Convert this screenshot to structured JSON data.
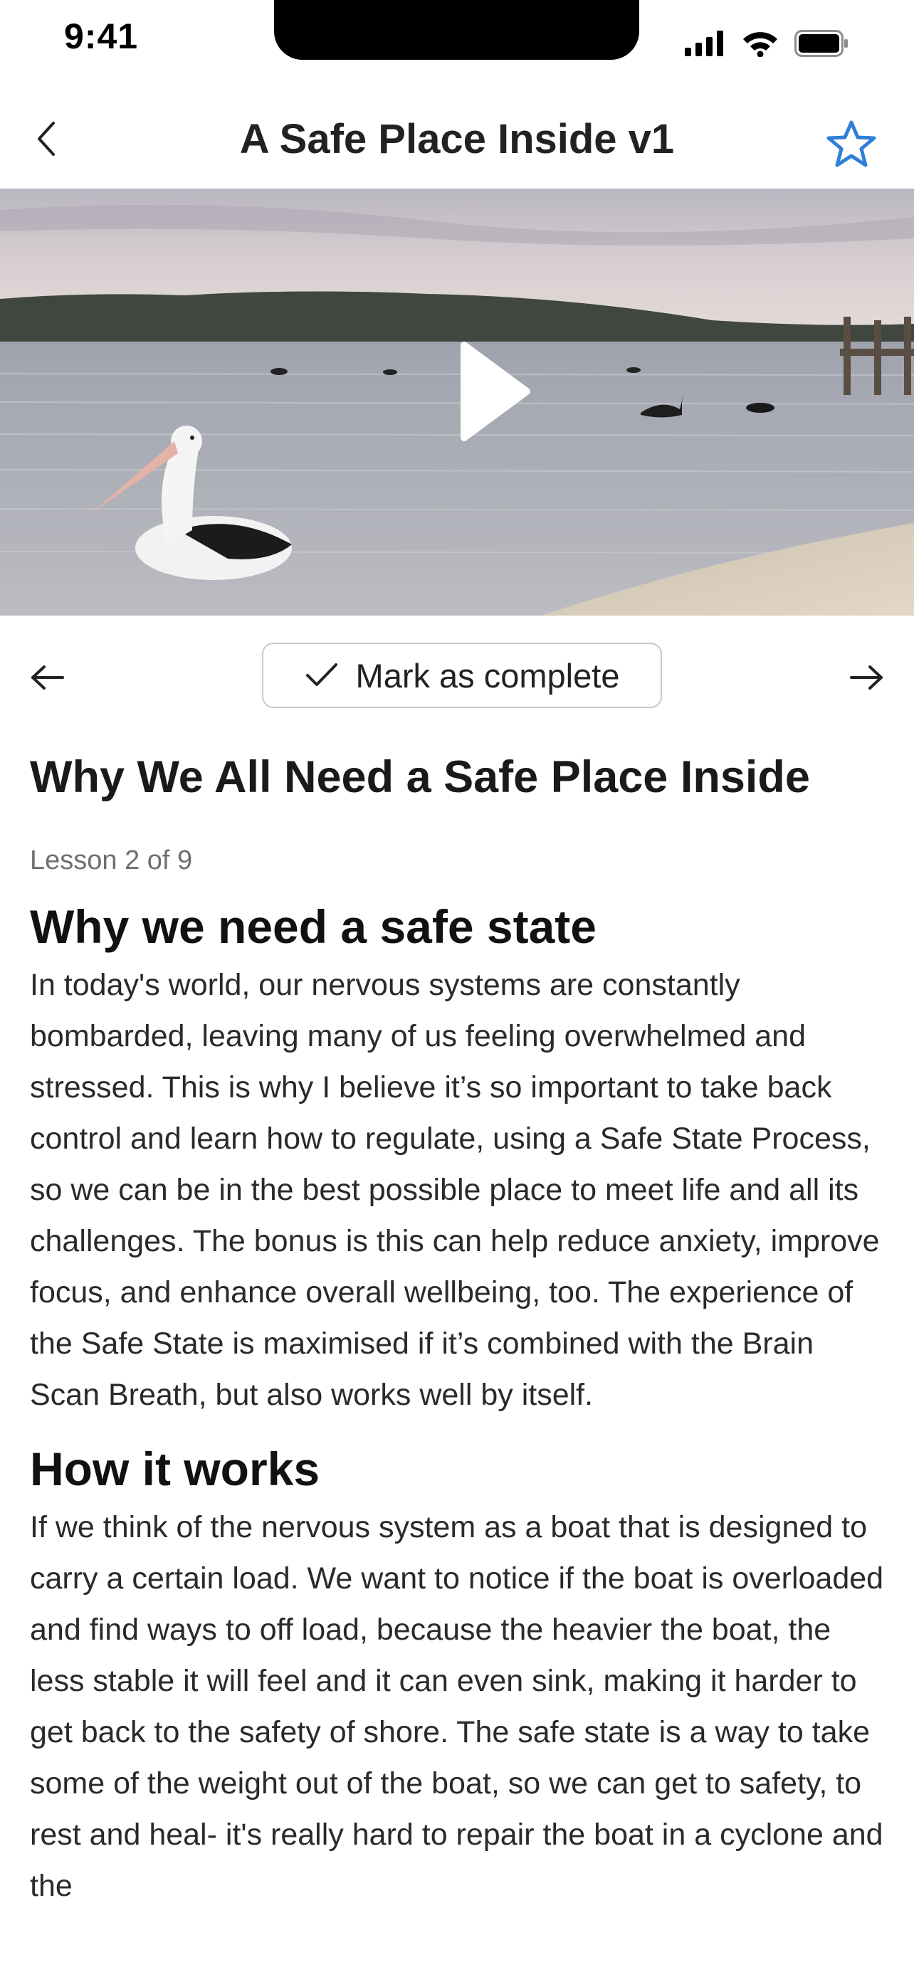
{
  "status_bar": {
    "time": "9:41"
  },
  "header": {
    "title": "A Safe Place Inside v1"
  },
  "controls": {
    "complete_label": "Mark as complete"
  },
  "lesson": {
    "title": "Why We All Need a Safe Place Inside",
    "meta": "Lesson 2 of 9"
  },
  "sections": [
    {
      "heading": "Why we need a safe state",
      "body": "In today's world, our nervous systems are constantly bombarded, leaving many of us feeling overwhelmed and stressed. This is why I believe it’s so important to take back control and learn how to regulate, using a Safe State Process, so we can be in the best possible place to meet life and all its challenges. The bonus is this can help reduce anxiety, improve focus, and enhance overall wellbeing, too. The experience of the Safe State is maximised if it’s combined with the Brain Scan Breath, but also works well by itself."
    },
    {
      "heading": "How it works",
      "body": "If we think of the nervous system as a boat that is designed to carry a certain load. We want to notice if the boat is overloaded and find ways to off load, because the heavier the boat, the less stable it will feel and it can even sink, making it harder to get back to the safety of shore. The safe state is a way to take some of the weight out of the boat, so we can get to safety, to rest and heal- it's really hard to repair the boat in a cyclone and the"
    }
  ],
  "colors": {
    "accent": "#2f7fd6",
    "border": "#c9c9c9",
    "meta": "#6f6f6f"
  },
  "icons": [
    "back-chevron-icon",
    "star-icon",
    "play-icon",
    "arrow-left-icon",
    "checkmark-icon",
    "arrow-right-icon"
  ]
}
